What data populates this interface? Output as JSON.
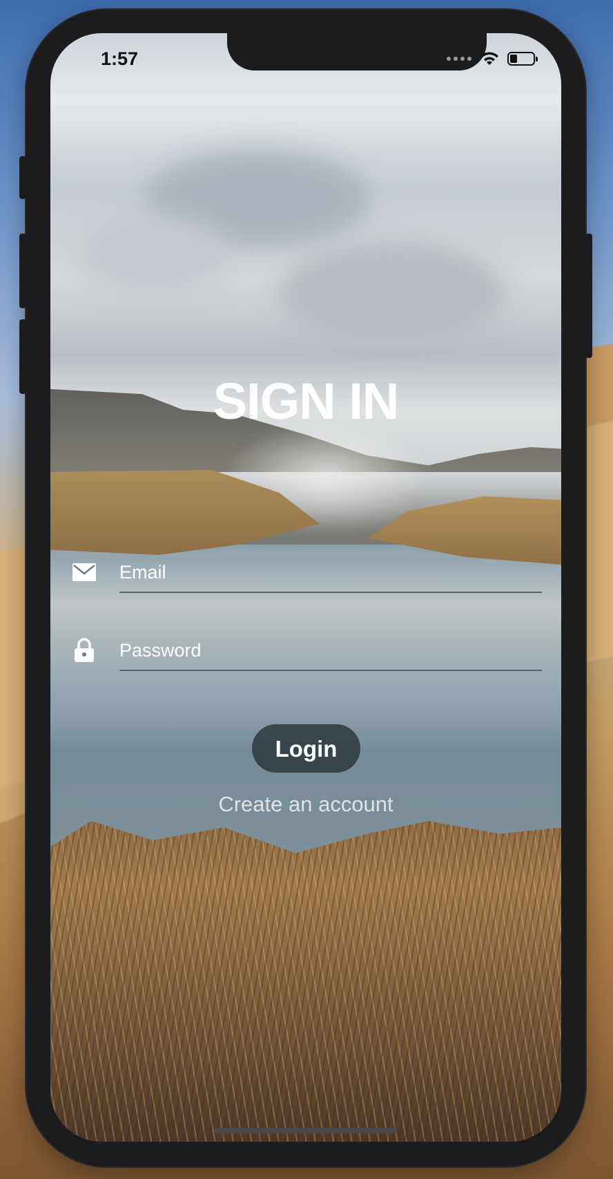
{
  "status_bar": {
    "time": "1:57",
    "battery_level": 0.3
  },
  "icons": {
    "email": "envelope-icon",
    "password": "lock-icon",
    "wifi": "wifi-icon",
    "signal": "cellular-signal-icon",
    "battery": "battery-icon"
  },
  "screen": {
    "title": "SIGN IN",
    "email_field": {
      "placeholder": "Email",
      "value": ""
    },
    "password_field": {
      "placeholder": "Password",
      "value": ""
    },
    "login_label": "Login",
    "create_account_label": "Create an account"
  },
  "colors": {
    "text": "#ffffff",
    "button_bg": "#283034",
    "underline": "#464646"
  }
}
